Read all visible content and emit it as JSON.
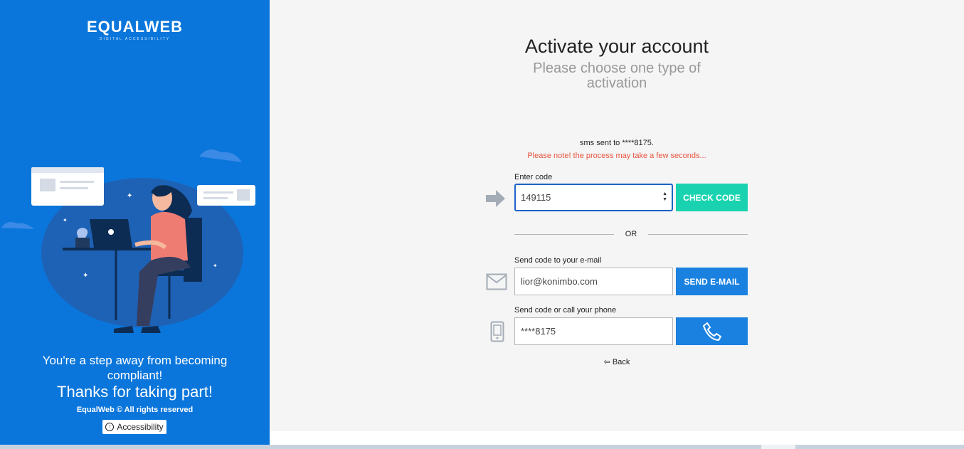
{
  "brand": {
    "logo_text": "EQUALWEB",
    "logo_subtext": "DIGITAL ACCESSIBILITY",
    "tagline": "You're a step away from becoming compliant!",
    "thanks": "Thanks for taking part!",
    "copyright": "EqualWeb © All rights reserved",
    "accessibility_button": "Accessibility"
  },
  "main": {
    "title": "Activate your account",
    "subtitle": "Please choose one type of activation",
    "sms_sent": "sms sent to ****8175.",
    "note": "Please note! the process may take a few seconds...",
    "code": {
      "label": "Enter code",
      "value": "149115",
      "button": "CHECK CODE"
    },
    "or_text": "OR",
    "email": {
      "label": "Send code to your e-mail",
      "value": "lior@konimbo.com",
      "button": "SEND E-MAIL"
    },
    "phone": {
      "label": "Send code or call your phone",
      "value": "****8175"
    },
    "back": "Back"
  },
  "colors": {
    "brand_blue": "#0a76db",
    "check_button": "#19d3b0",
    "action_blue": "#1a81e0",
    "note_red": "#e8543f"
  }
}
